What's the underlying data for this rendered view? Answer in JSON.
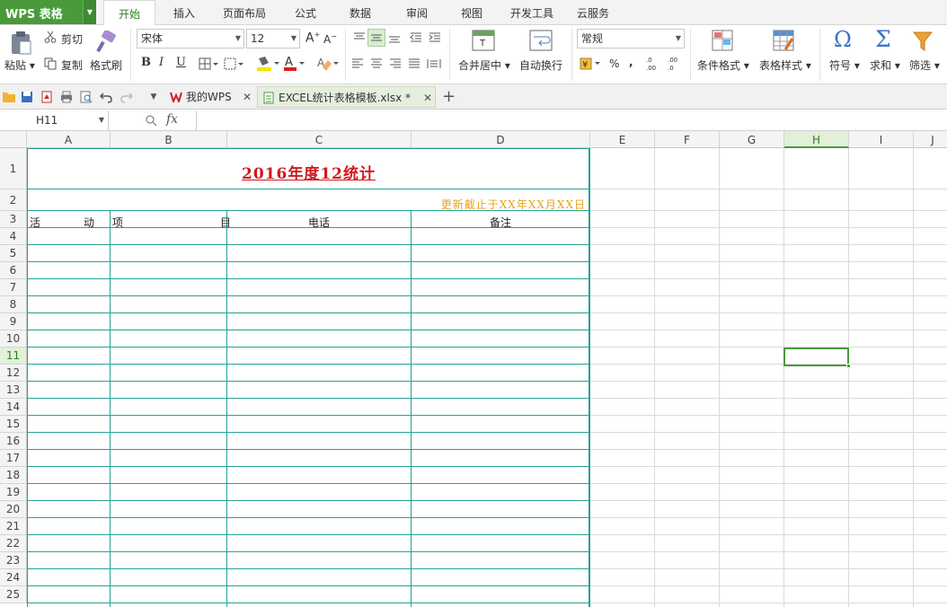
{
  "app": {
    "name": "WPS 表格"
  },
  "menus": [
    "开始",
    "插入",
    "页面布局",
    "公式",
    "数据",
    "审阅",
    "视图",
    "开发工具",
    "云服务"
  ],
  "ribbon": {
    "paste": "粘贴",
    "cut": "剪切",
    "copy": "复制",
    "format_painter": "格式刷",
    "font_name": "宋体",
    "font_size": "12",
    "bold": "B",
    "italic": "I",
    "underline": "U",
    "merge_center": "合并居中",
    "wrap_text": "自动换行",
    "number_format": "常规",
    "percent": "%",
    "comma": ",",
    "conditional_format": "条件格式",
    "table_style": "表格样式",
    "symbol": "符号",
    "sum": "求和",
    "filter": "筛选"
  },
  "doc_tabs": [
    {
      "label": "我的WPS"
    },
    {
      "label": "EXCEL统计表格模板.xlsx *"
    }
  ],
  "formula_bar": {
    "name_box": "H11",
    "fx": "fx",
    "formula": ""
  },
  "columns": [
    "A",
    "B",
    "C",
    "D",
    "E",
    "F",
    "G",
    "H",
    "I",
    "J"
  ],
  "rows": [
    "1",
    "2",
    "3",
    "4",
    "5",
    "6",
    "7",
    "8",
    "9",
    "10",
    "11",
    "12",
    "13",
    "14",
    "15",
    "16",
    "17",
    "18",
    "19",
    "20",
    "21",
    "22",
    "23",
    "24",
    "25"
  ],
  "selected": {
    "column": "H",
    "row": "11"
  },
  "sheet": {
    "title": "2016年度12统计",
    "updated": "更新截止于XX年XX月XX日",
    "headers": {
      "activity_a": "活　　　　动",
      "activity_b": "项　　　　　　　　　目",
      "phone": "电话",
      "note": "备注"
    }
  },
  "colors": {
    "accent": "#4a9a3c",
    "title": "#d0191f",
    "updated": "#e8a317",
    "table_border": "#27a293"
  }
}
